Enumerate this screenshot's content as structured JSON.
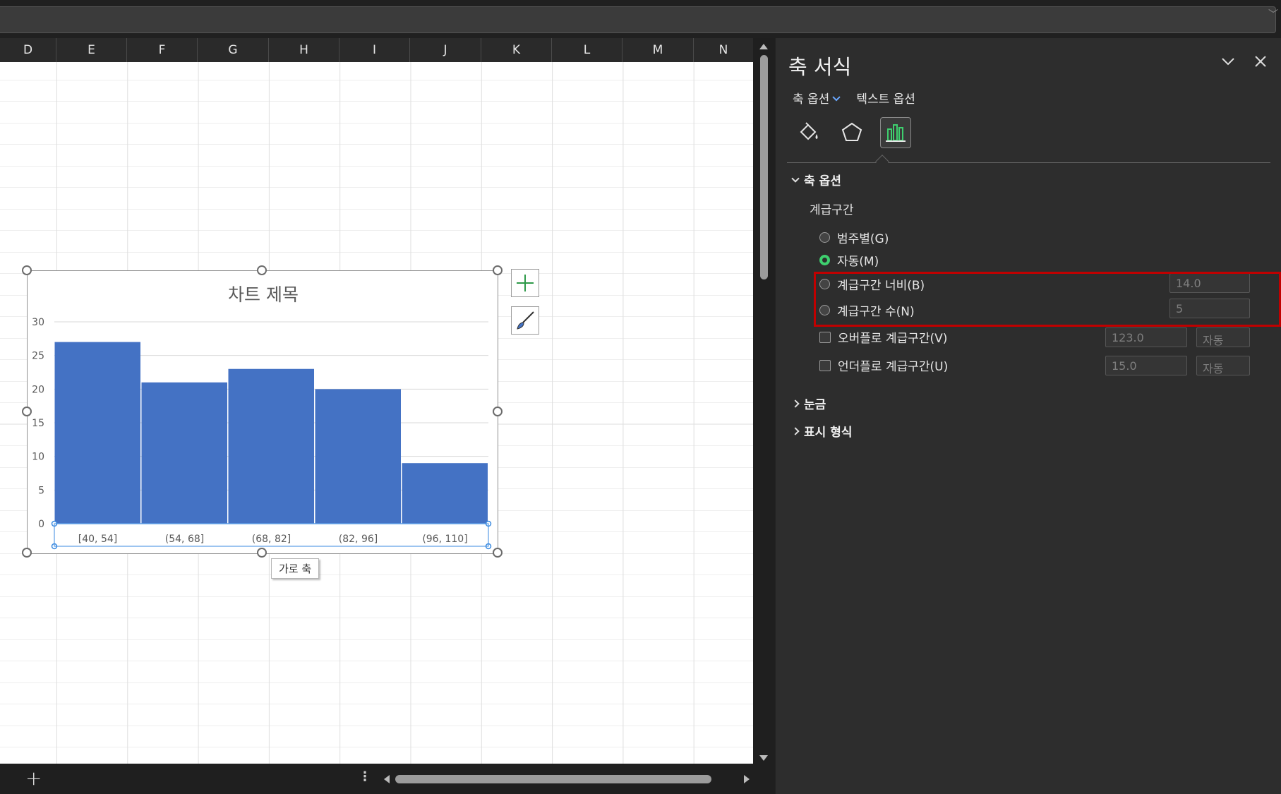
{
  "columns": [
    "D",
    "E",
    "F",
    "G",
    "H",
    "I",
    "J",
    "K",
    "L",
    "M",
    "N"
  ],
  "chart_data": {
    "type": "bar",
    "title": "차트 제목",
    "categories": [
      "[40, 54]",
      "(54, 68]",
      "(68, 82]",
      "(82, 96]",
      "(96, 110]"
    ],
    "values": [
      27,
      21,
      23,
      20,
      9
    ],
    "yticks": [
      "0",
      "5",
      "10",
      "15",
      "20",
      "25",
      "30"
    ],
    "ylim": [
      0,
      30
    ],
    "grid": true,
    "bar_color": "#4472C4"
  },
  "tooltip": "가로 축",
  "pane": {
    "title": "축 서식",
    "tabs": [
      "축 옵션",
      "텍스트 옵션"
    ],
    "icons": [
      "fill-line-icon",
      "effects-icon",
      "axis-options-icon"
    ],
    "section_axis_options": "축 옵션",
    "group_label": "계급구간",
    "options": [
      {
        "label": "범주별(G)",
        "type": "radio",
        "checked": false
      },
      {
        "label": "자동(M)",
        "type": "radio",
        "checked": true
      },
      {
        "label": "계급구간 너비(B)",
        "type": "radio",
        "checked": false,
        "value": "14.0"
      },
      {
        "label": "계급구간 수(N)",
        "type": "radio",
        "checked": false,
        "value": "5"
      },
      {
        "label": "오버플로 계급구간(V)",
        "type": "checkbox",
        "checked": false,
        "value": "123.0",
        "auto": "자동"
      },
      {
        "label": "언더플로 계급구간(U)",
        "type": "checkbox",
        "checked": false,
        "value": "15.0",
        "auto": "자동"
      }
    ],
    "section_ticks": "눈금",
    "section_number_format": "표시 형식"
  },
  "colors": {
    "accent_green": "#3ecf6e",
    "highlight_red": "#c00000",
    "pane_bg": "#2d2d2d"
  }
}
